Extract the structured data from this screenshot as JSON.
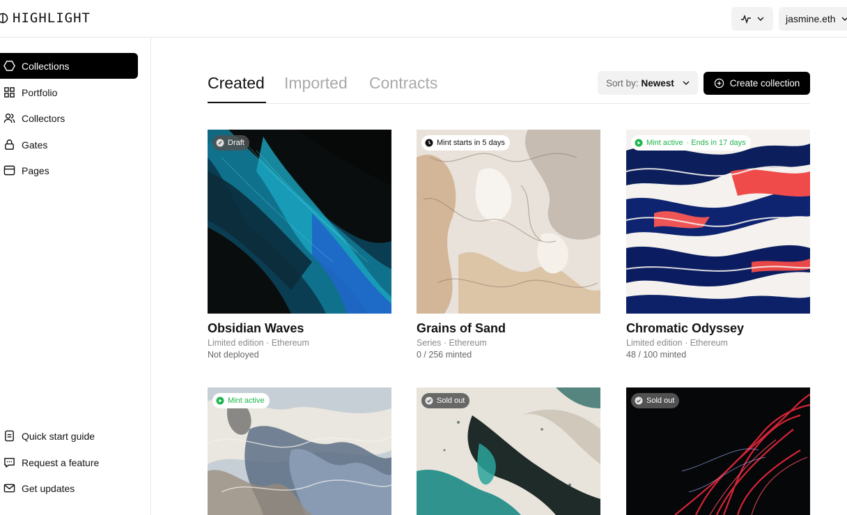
{
  "header": {
    "logo_text": "HIGHLIGHT",
    "user": "jasmine.eth"
  },
  "sidebar": {
    "items": [
      {
        "label": "Collections",
        "icon": "hexagon-icon"
      },
      {
        "label": "Portfolio",
        "icon": "grid-icon"
      },
      {
        "label": "Collectors",
        "icon": "users-icon"
      },
      {
        "label": "Gates",
        "icon": "lock-icon"
      },
      {
        "label": "Pages",
        "icon": "browser-icon"
      }
    ],
    "footer": [
      {
        "label": "Quick start guide",
        "icon": "document-icon"
      },
      {
        "label": "Request a feature",
        "icon": "chat-icon"
      },
      {
        "label": "Get updates",
        "icon": "mail-icon"
      }
    ]
  },
  "tabs": [
    "Created",
    "Imported",
    "Contracts"
  ],
  "sort": {
    "prefix": "Sort by:",
    "value": "Newest"
  },
  "create_label": "Create collection",
  "cards": [
    {
      "badge": "Draft",
      "title": "Obsidian Waves",
      "meta": "Limited edition · Ethereum",
      "status": "Not deployed"
    },
    {
      "badge": "Mint starts in 5 days",
      "title": "Grains of Sand",
      "meta": "Series · Ethereum",
      "status": "0 / 256 minted"
    },
    {
      "badge_a": "Mint active",
      "badge_b": "· Ends in 17 days",
      "title": "Chromatic Odyssey",
      "meta": "Limited edition · Ethereum",
      "status": "48 / 100 minted"
    },
    {
      "badge": "Mint active"
    },
    {
      "badge": "Sold out"
    },
    {
      "badge": "Sold out"
    }
  ],
  "colors": {
    "accent": "#000000",
    "active_green": "#1bb54b"
  }
}
